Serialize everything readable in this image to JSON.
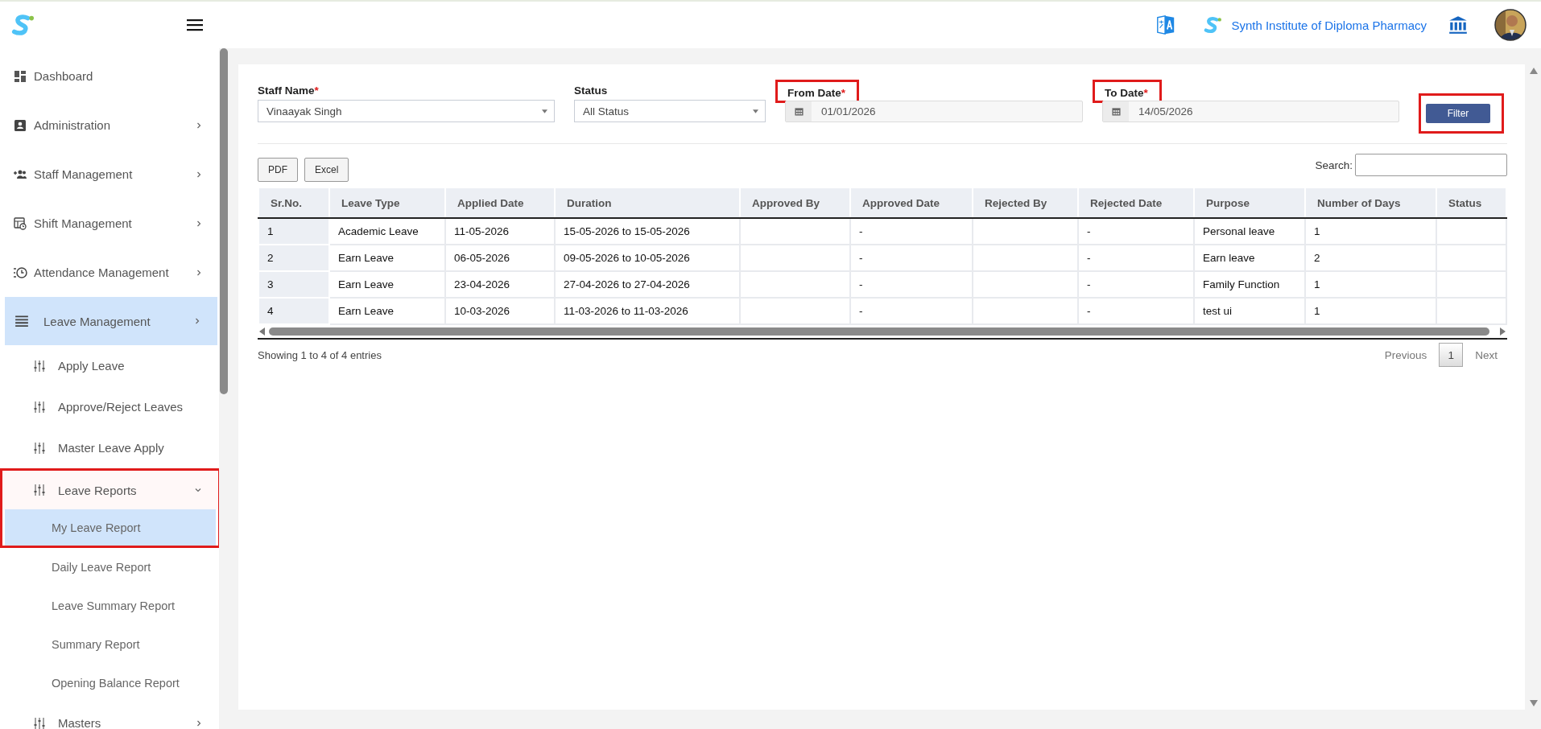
{
  "header": {
    "institute_name": "Synth Institute of Diploma Pharmacy"
  },
  "sidebar": {
    "items": [
      {
        "label": "Dashboard",
        "selected": false
      },
      {
        "label": "Administration",
        "selected": false,
        "expanded": false
      },
      {
        "label": "Staff Management",
        "selected": false,
        "expanded": false
      },
      {
        "label": "Shift Management",
        "selected": false,
        "expanded": false
      },
      {
        "label": "Attendance Management",
        "selected": false,
        "expanded": false
      },
      {
        "label": "Leave Management",
        "selected": true,
        "expanded": false,
        "children": [
          {
            "label": "Apply Leave",
            "selected": false
          },
          {
            "label": "Approve/Reject Leaves",
            "selected": false
          },
          {
            "label": "Master Leave Apply",
            "selected": false
          },
          {
            "label": "Leave Reports",
            "selected": false,
            "expanded": true,
            "highlighted": true,
            "children": [
              {
                "label": "My Leave Report",
                "selected": true,
                "highlighted": true
              },
              {
                "label": "Daily Leave Report",
                "selected": false,
                "highlighted": false
              },
              {
                "label": "Leave Summary Report",
                "selected": false,
                "highlighted": false
              },
              {
                "label": "Summary Report",
                "selected": false,
                "highlighted": false
              },
              {
                "label": "Opening Balance Report",
                "selected": false,
                "highlighted": false
              }
            ]
          },
          {
            "label": "Masters",
            "selected": false,
            "expanded": false
          }
        ]
      }
    ]
  },
  "filters": [
    {
      "kind": "select",
      "label": "Staff Name",
      "required_mark": "*",
      "highlighted": false,
      "value": "Vinaayak Singh"
    },
    {
      "kind": "select",
      "label": "Status",
      "highlighted": false,
      "value": "All Status"
    },
    {
      "kind": "date",
      "label": "From Date",
      "required_mark": "*",
      "highlighted": true,
      "value": "01/01/2026"
    },
    {
      "kind": "date",
      "label": "To Date",
      "required_mark": "*",
      "highlighted": true,
      "value": "14/05/2026"
    }
  ],
  "filter_button": {
    "label": "Filter",
    "highlighted": true
  },
  "export_buttons": [
    "PDF",
    "Excel"
  ],
  "search": {
    "label": "Search:"
  },
  "table": {
    "columns": [
      "Sr.No.",
      "Leave Type",
      "Applied Date",
      "Duration",
      "Approved By",
      "Approved Date",
      "Rejected By",
      "Rejected Date",
      "Purpose",
      "Number of Days",
      "Status"
    ],
    "rows": [
      [
        "1",
        "Academic Leave",
        "11-05-2026",
        "15-05-2026 to 15-05-2026",
        "",
        "-",
        "",
        "-",
        "Personal leave",
        "1",
        ""
      ],
      [
        "2",
        "Earn Leave",
        "06-05-2026",
        "09-05-2026 to 10-05-2026",
        "",
        "-",
        "",
        "-",
        "Earn leave",
        "2",
        ""
      ],
      [
        "3",
        "Earn Leave",
        "23-04-2026",
        "27-04-2026 to 27-04-2026",
        "",
        "-",
        "",
        "-",
        "Family Function",
        "1",
        ""
      ],
      [
        "4",
        "Earn Leave",
        "10-03-2026",
        "11-03-2026 to 11-03-2026",
        "",
        "-",
        "",
        "-",
        "test ui",
        "1",
        ""
      ]
    ]
  },
  "table_info": "Showing 1 to 4 of 4 entries",
  "pagination": {
    "previous": "Previous",
    "pages": [
      {
        "label": "1",
        "selected": true
      }
    ],
    "next": "Next"
  }
}
